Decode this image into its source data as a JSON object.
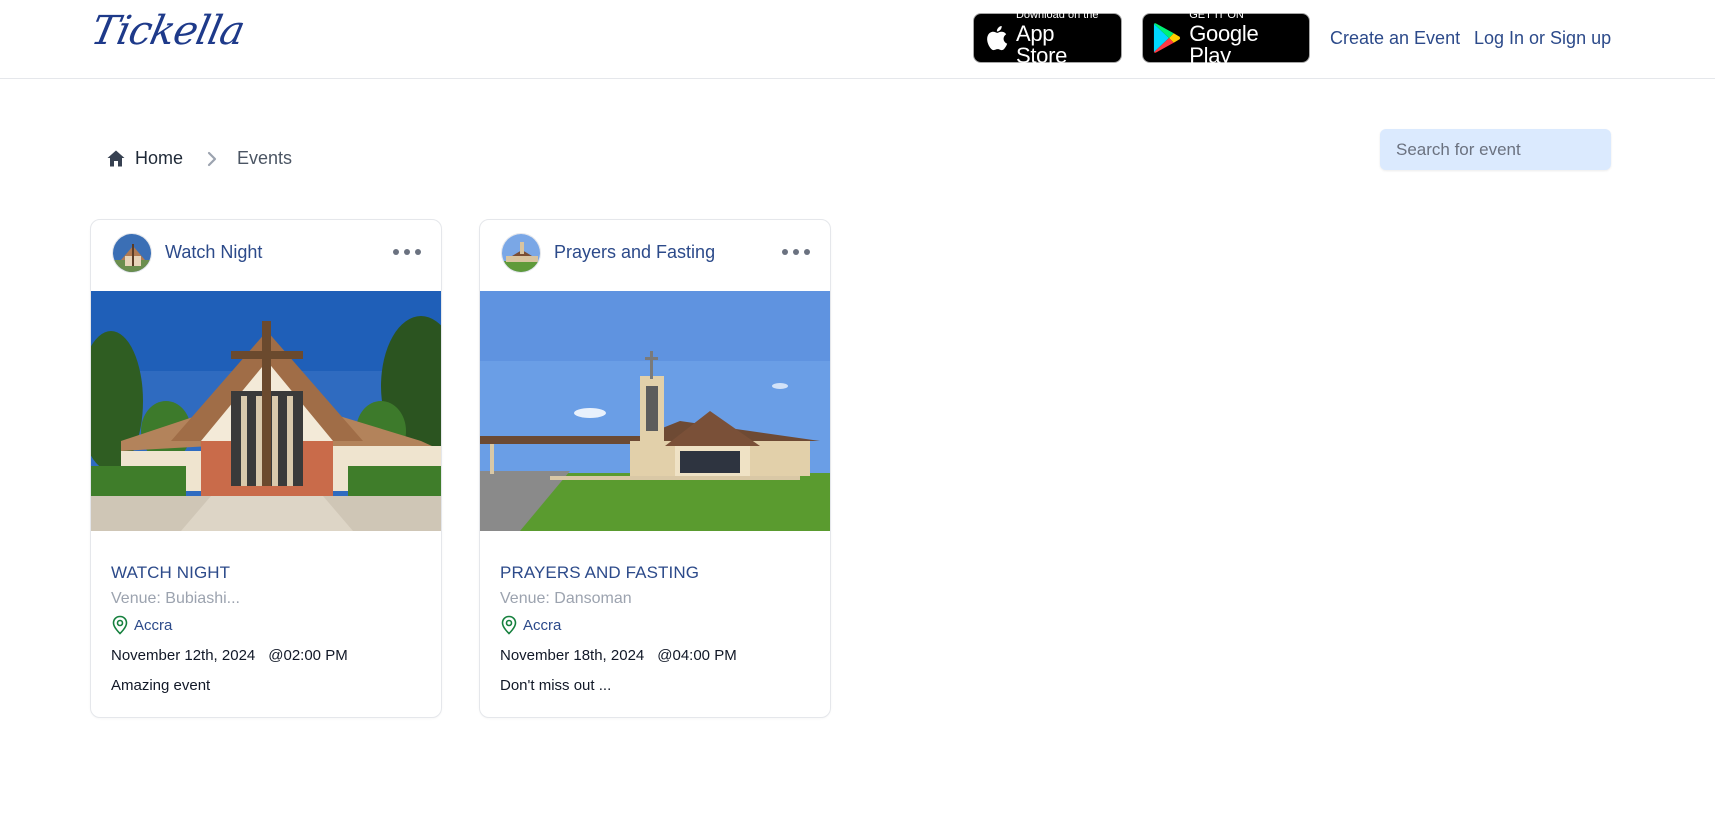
{
  "brand": {
    "logo_text": "Tickella"
  },
  "header": {
    "app_store": {
      "small": "Download on the",
      "big": "App Store"
    },
    "google_play": {
      "small": "GET IT ON",
      "big": "Google Play"
    },
    "create_event": "Create an Event",
    "login": "Log In or Sign up"
  },
  "breadcrumb": {
    "home": "Home",
    "current": "Events"
  },
  "search": {
    "placeholder": "Search for event",
    "value": ""
  },
  "events": [
    {
      "name": "Watch Night",
      "title": "WATCH NIGHT",
      "venue": "Venue: Bubiashi...",
      "city": "Accra",
      "date": "November 12th, 2024",
      "time": "@02:00 PM",
      "description": "Amazing event"
    },
    {
      "name": "Prayers and Fasting",
      "title": "PRAYERS AND FASTING",
      "venue": "Venue: Dansoman",
      "city": "Accra",
      "date": "November 18th, 2024",
      "time": "@04:00 PM",
      "description": "Don't miss out ..."
    }
  ],
  "icons": {
    "home": "home-icon",
    "chevron": "chevron-right-icon",
    "more": "more-horizontal-icon",
    "location": "map-pin-icon",
    "apple": "apple-icon",
    "play": "google-play-icon"
  },
  "colors": {
    "brand_blue": "#2c4a8a",
    "search_bg": "#dbeafe",
    "location_green": "#15803d",
    "muted": "#9ca3af"
  }
}
